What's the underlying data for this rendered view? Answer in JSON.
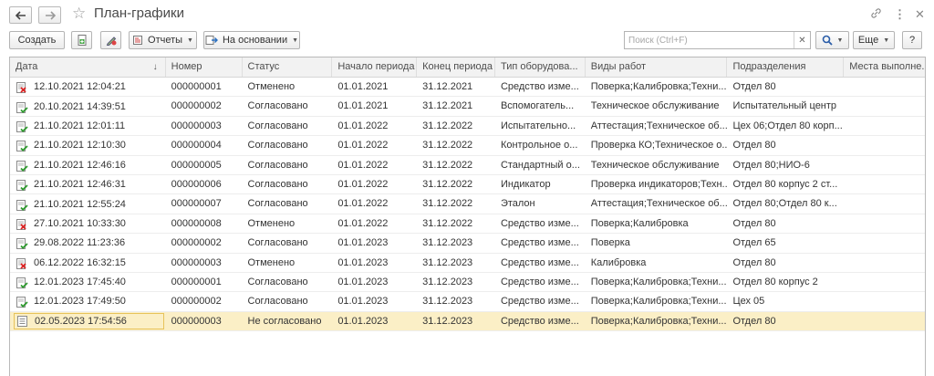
{
  "window": {
    "title": "План-графики"
  },
  "toolbar": {
    "create_label": "Создать",
    "reports_label": "Отчеты",
    "based_on_label": "На основании",
    "more_label": "Еще",
    "help_label": "?"
  },
  "search": {
    "placeholder": "Поиск (Ctrl+F)",
    "value": ""
  },
  "table": {
    "columns": [
      "Дата",
      "Номер",
      "Статус",
      "Начало периода",
      "Конец периода",
      "Тип оборудова...",
      "Виды работ",
      "Подразделения",
      "Места выполне..."
    ],
    "rows": [
      {
        "date": "12.10.2021 12:04:21",
        "number": "000000001",
        "status": "Отменено",
        "start": "01.01.2021",
        "end": "31.12.2021",
        "type": "Средство изме...",
        "works": "Поверка;Калибровка;Техни...",
        "dept": "Отдел 80",
        "place": "",
        "icon": "cancelled-doc-icon"
      },
      {
        "date": "20.10.2021 14:39:51",
        "number": "000000002",
        "status": "Согласовано",
        "start": "01.01.2021",
        "end": "31.12.2021",
        "type": "Вспомогатель...",
        "works": "Техническое обслуживание",
        "dept": "Испытательный центр",
        "place": "",
        "icon": "approved-doc-icon"
      },
      {
        "date": "21.10.2021 12:01:11",
        "number": "000000003",
        "status": "Согласовано",
        "start": "01.01.2022",
        "end": "31.12.2022",
        "type": "Испытательно...",
        "works": "Аттестация;Техническое об...",
        "dept": "Цех 06;Отдел 80 корп...",
        "place": "",
        "icon": "approved-doc-icon"
      },
      {
        "date": "21.10.2021 12:10:30",
        "number": "000000004",
        "status": "Согласовано",
        "start": "01.01.2022",
        "end": "31.12.2022",
        "type": "Контрольное о...",
        "works": "Проверка КО;Техническое о...",
        "dept": "Отдел 80",
        "place": "",
        "icon": "approved-doc-icon"
      },
      {
        "date": "21.10.2021 12:46:16",
        "number": "000000005",
        "status": "Согласовано",
        "start": "01.01.2022",
        "end": "31.12.2022",
        "type": "Стандартный о...",
        "works": "Техническое обслуживание",
        "dept": "Отдел 80;НИО-6",
        "place": "",
        "icon": "approved-doc-icon"
      },
      {
        "date": "21.10.2021 12:46:31",
        "number": "000000006",
        "status": "Согласовано",
        "start": "01.01.2022",
        "end": "31.12.2022",
        "type": "Индикатор",
        "works": "Проверка индикаторов;Техн...",
        "dept": "Отдел 80 корпус 2 ст...",
        "place": "",
        "icon": "approved-doc-icon"
      },
      {
        "date": "21.10.2021 12:55:24",
        "number": "000000007",
        "status": "Согласовано",
        "start": "01.01.2022",
        "end": "31.12.2022",
        "type": "Эталон",
        "works": "Аттестация;Техническое об...",
        "dept": "Отдел 80;Отдел 80 к...",
        "place": "",
        "icon": "approved-doc-icon"
      },
      {
        "date": "27.10.2021 10:33:30",
        "number": "000000008",
        "status": "Отменено",
        "start": "01.01.2022",
        "end": "31.12.2022",
        "type": "Средство изме...",
        "works": "Поверка;Калибровка",
        "dept": "Отдел 80",
        "place": "",
        "icon": "cancelled-doc-icon"
      },
      {
        "date": "29.08.2022 11:23:36",
        "number": "000000002",
        "status": "Согласовано",
        "start": "01.01.2023",
        "end": "31.12.2023",
        "type": "Средство изме...",
        "works": "Поверка",
        "dept": "Отдел 65",
        "place": "",
        "icon": "approved-doc-icon"
      },
      {
        "date": "06.12.2022 16:32:15",
        "number": "000000003",
        "status": "Отменено",
        "start": "01.01.2023",
        "end": "31.12.2023",
        "type": "Средство изме...",
        "works": "Калибровка",
        "dept": "Отдел 80",
        "place": "",
        "icon": "cancelled-doc-icon"
      },
      {
        "date": "12.01.2023 17:45:40",
        "number": "000000001",
        "status": "Согласовано",
        "start": "01.01.2023",
        "end": "31.12.2023",
        "type": "Средство изме...",
        "works": "Поверка;Калибровка;Техни...",
        "dept": "Отдел 80 корпус 2",
        "place": "",
        "icon": "approved-doc-icon"
      },
      {
        "date": "12.01.2023 17:49:50",
        "number": "000000002",
        "status": "Согласовано",
        "start": "01.01.2023",
        "end": "31.12.2023",
        "type": "Средство изме...",
        "works": "Поверка;Калибровка;Техни...",
        "dept": "Цех 05",
        "place": "",
        "icon": "approved-doc-icon"
      },
      {
        "date": "02.05.2023 17:54:56",
        "number": "000000003",
        "status": "Не согласовано",
        "start": "01.01.2023",
        "end": "31.12.2023",
        "type": "Средство изме...",
        "works": "Поверка;Калибровка;Техни...",
        "dept": "Отдел 80",
        "place": "",
        "icon": "draft-doc-icon",
        "selected": true
      }
    ]
  }
}
